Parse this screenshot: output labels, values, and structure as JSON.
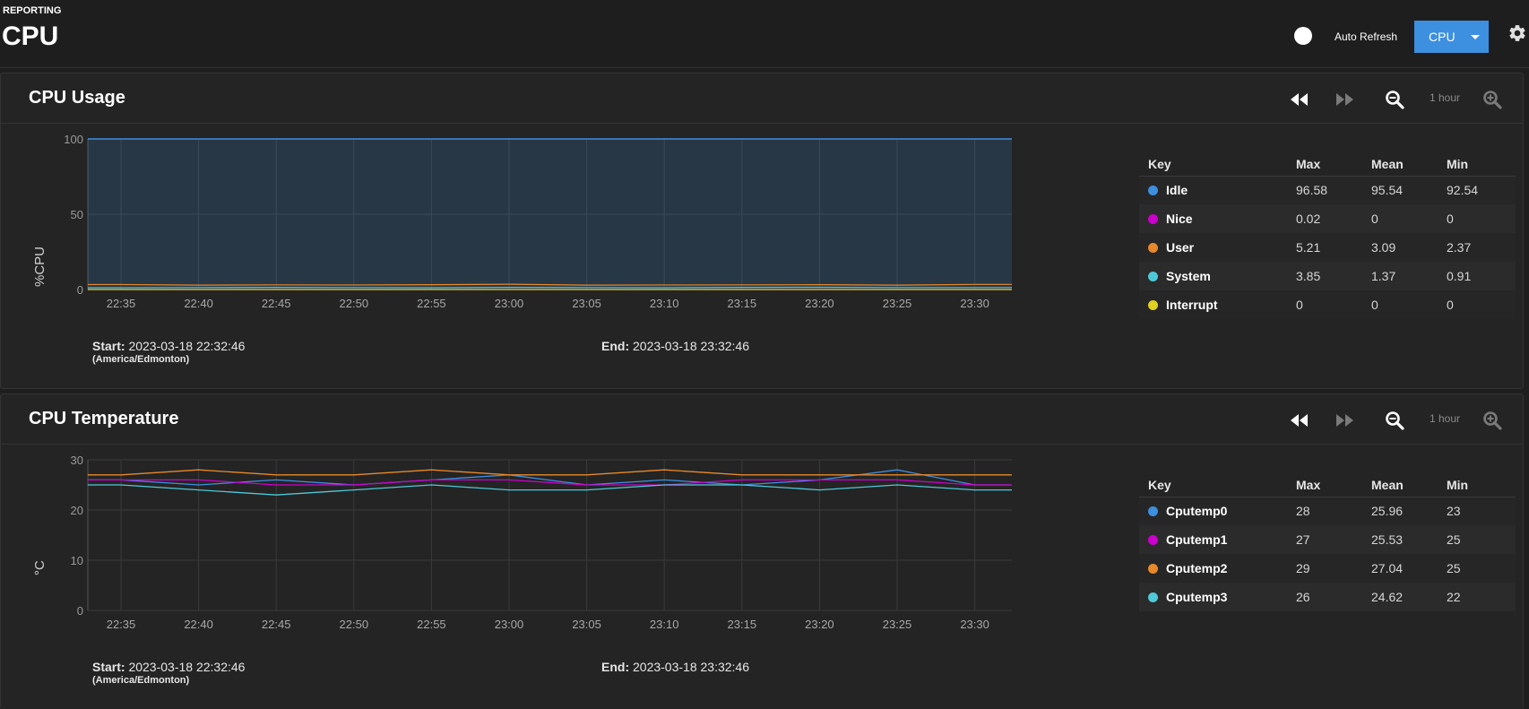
{
  "header": {
    "breadcrumb": "REPORTING",
    "title": "CPU",
    "auto_refresh_label": "Auto Refresh",
    "auto_refresh_on": false,
    "selector_value": "CPU"
  },
  "icons": {
    "gear": "gear-icon",
    "rewind": "rewind-icon",
    "fast_forward": "fast-forward-icon",
    "zoom_out": "zoom-out-icon",
    "zoom_in": "zoom-in-icon"
  },
  "colors": {
    "accent": "#3d8fe0",
    "idle": "#3d8fe0",
    "nice": "#cc00cc",
    "user": "#e8882a",
    "system": "#4fc8d8",
    "interrupt": "#e0d020"
  },
  "cards": [
    {
      "title": "CPU Usage",
      "range": "1 hour",
      "start_label": "Start:",
      "start_value": "2023-03-18 22:32:46",
      "timezone": "(America/Edmonton)",
      "end_label": "End:",
      "end_value": "2023-03-18 23:32:46",
      "legend": {
        "headers": [
          "Key",
          "Max",
          "Mean",
          "Min"
        ],
        "rows": [
          {
            "name": "Idle",
            "max": "96.58",
            "mean": "95.54",
            "min": "92.54",
            "color": "#3d8fe0"
          },
          {
            "name": "Nice",
            "max": "0.02",
            "mean": "0",
            "min": "0",
            "color": "#cc00cc"
          },
          {
            "name": "User",
            "max": "5.21",
            "mean": "3.09",
            "min": "2.37",
            "color": "#e8882a"
          },
          {
            "name": "System",
            "max": "3.85",
            "mean": "1.37",
            "min": "0.91",
            "color": "#4fc8d8"
          },
          {
            "name": "Interrupt",
            "max": "0",
            "mean": "0",
            "min": "0",
            "color": "#e0d020"
          }
        ]
      }
    },
    {
      "title": "CPU Temperature",
      "range": "1 hour",
      "start_label": "Start:",
      "start_value": "2023-03-18 22:32:46",
      "timezone": "(America/Edmonton)",
      "end_label": "End:",
      "end_value": "2023-03-18 23:32:46",
      "legend": {
        "headers": [
          "Key",
          "Max",
          "Mean",
          "Min"
        ],
        "rows": [
          {
            "name": "Cputemp0",
            "max": "28",
            "mean": "25.96",
            "min": "23",
            "color": "#3d8fe0"
          },
          {
            "name": "Cputemp1",
            "max": "27",
            "mean": "25.53",
            "min": "25",
            "color": "#cc00cc"
          },
          {
            "name": "Cputemp2",
            "max": "29",
            "mean": "27.04",
            "min": "25",
            "color": "#e8882a"
          },
          {
            "name": "Cputemp3",
            "max": "26",
            "mean": "24.62",
            "min": "22",
            "color": "#4fc8d8"
          }
        ]
      }
    }
  ],
  "chart_data": [
    {
      "type": "area",
      "title": "CPU Usage",
      "ylabel": "%CPU",
      "xlabel": "",
      "ylim": [
        0,
        100
      ],
      "yticks": [
        0,
        50,
        100
      ],
      "x": [
        "22:35",
        "22:40",
        "22:45",
        "22:50",
        "22:55",
        "23:00",
        "23:05",
        "23:10",
        "23:15",
        "23:20",
        "23:25",
        "23:30"
      ],
      "grid": true,
      "legend_placement": "right",
      "series": [
        {
          "name": "Idle",
          "color": "#3d8fe0",
          "values": [
            95.5,
            95.8,
            95.4,
            95.6,
            95.5,
            95.2,
            95.6,
            95.7,
            95.5,
            95.4,
            95.6,
            95.3
          ]
        },
        {
          "name": "Nice",
          "color": "#cc00cc",
          "values": [
            0,
            0,
            0,
            0,
            0,
            0,
            0,
            0,
            0,
            0,
            0,
            0
          ]
        },
        {
          "name": "User",
          "color": "#e8882a",
          "values": [
            3.3,
            2.9,
            3.1,
            3.0,
            3.2,
            3.5,
            2.9,
            3.0,
            3.1,
            3.2,
            2.9,
            3.4
          ]
        },
        {
          "name": "System",
          "color": "#4fc8d8",
          "values": [
            1.2,
            1.3,
            1.4,
            1.3,
            1.2,
            1.4,
            1.3,
            1.2,
            1.4,
            1.5,
            1.3,
            1.3
          ]
        },
        {
          "name": "Interrupt",
          "color": "#e0d020",
          "values": [
            0,
            0,
            0,
            0,
            0,
            0,
            0,
            0,
            0,
            0,
            0,
            0
          ]
        }
      ]
    },
    {
      "type": "line",
      "title": "CPU Temperature",
      "ylabel": "°C",
      "xlabel": "",
      "ylim": [
        0,
        30
      ],
      "yticks": [
        0,
        10,
        20,
        30
      ],
      "x": [
        "22:35",
        "22:40",
        "22:45",
        "22:50",
        "22:55",
        "23:00",
        "23:05",
        "23:10",
        "23:15",
        "23:20",
        "23:25",
        "23:30"
      ],
      "grid": true,
      "legend_placement": "right",
      "series": [
        {
          "name": "Cputemp0",
          "color": "#3d8fe0",
          "values": [
            26,
            25,
            26,
            25,
            26,
            27,
            25,
            26,
            25,
            26,
            28,
            25
          ]
        },
        {
          "name": "Cputemp1",
          "color": "#cc00cc",
          "values": [
            26,
            26,
            25,
            25,
            26,
            26,
            25,
            25,
            26,
            26,
            26,
            25
          ]
        },
        {
          "name": "Cputemp2",
          "color": "#e8882a",
          "values": [
            27,
            28,
            27,
            27,
            28,
            27,
            27,
            28,
            27,
            27,
            27,
            27
          ]
        },
        {
          "name": "Cputemp3",
          "color": "#4fc8d8",
          "values": [
            25,
            24,
            23,
            24,
            25,
            24,
            24,
            25,
            25,
            24,
            25,
            24
          ]
        }
      ]
    }
  ]
}
